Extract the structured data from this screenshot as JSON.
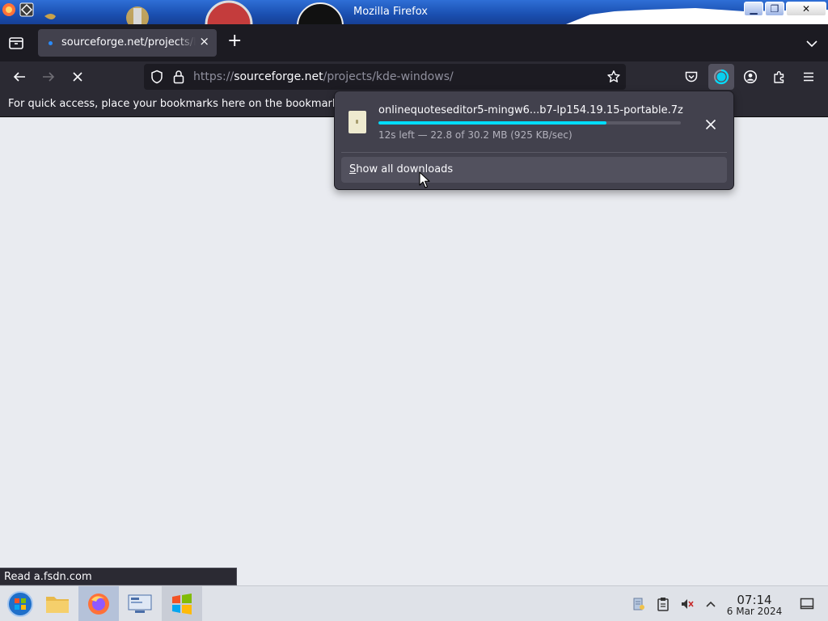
{
  "window": {
    "title": "Mozilla Firefox"
  },
  "tabs": [
    {
      "label": "sourceforge.net/projects/kde-windows/",
      "close_glyph": "×"
    }
  ],
  "tabstrip": {
    "new_tab_glyph": "+",
    "list_all_tabs_glyph": "⌄"
  },
  "navbar": {
    "url_scheme": "https://",
    "url_host": "sourceforge.net",
    "url_path": "/projects/kde-windows/",
    "icons": [
      "back-icon",
      "forward-icon",
      "stop-icon",
      "shield-icon",
      "lock-icon",
      "bookmark-star-icon",
      "pocket-icon",
      "downloads-icon",
      "account-icon",
      "extensions-icon",
      "menu-icon"
    ]
  },
  "bookmarks_bar": {
    "text": "For quick access, place your bookmarks here on the bookmarks toolbar."
  },
  "download_panel": {
    "filename": "onlinequoteseditor5-mingw6...b7-lp154.19.15-portable.7z",
    "status": "12s left — 22.8 of 30.2 MB (925 KB/sec)",
    "progress_fraction": 0.755,
    "show_all_label_access_key": "S",
    "show_all_label_rest": "how all downloads"
  },
  "status_tooltip": {
    "text": "Read a.fsdn.com"
  },
  "taskbar": {
    "items": [
      "start-menu-button",
      "file-manager",
      "firefox",
      "system-settings",
      "windows-logo-app"
    ],
    "clock_time": "07:14",
    "clock_date": "6 Mar 2024"
  },
  "colors": {
    "accent": "#00ddff",
    "toolbar": "#2b2a33",
    "tabstrip": "#1c1b22",
    "panel": "#42414d",
    "content": "#e9ebf0"
  }
}
